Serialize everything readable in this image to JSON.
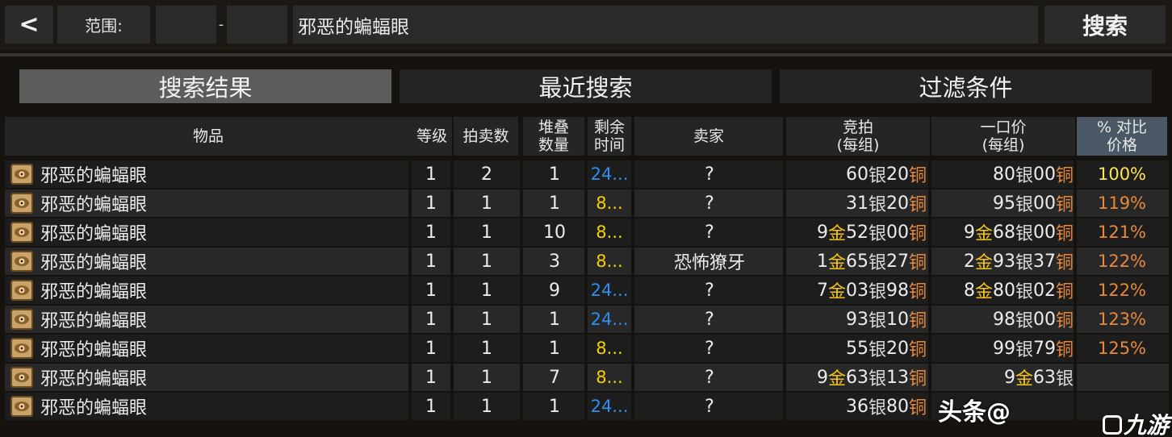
{
  "header": {
    "back_label": "<",
    "range_label": "范围:",
    "range_min": "",
    "range_dash": "-",
    "range_max": "",
    "search_value": "邪恶的蝙蝠眼",
    "search_button": "搜索"
  },
  "tabs": [
    {
      "label": "搜索结果",
      "active": true
    },
    {
      "label": "最近搜索",
      "active": false
    },
    {
      "label": "过滤条件",
      "active": false
    }
  ],
  "columns": {
    "item": "物品",
    "level": "等级",
    "bids": "拍卖数",
    "stack_1": "堆叠",
    "stack_2": "数量",
    "time_1": "剩余",
    "time_2": "时间",
    "seller": "卖家",
    "bid_1": "竞拍",
    "bid_2": "(每组)",
    "buyout_1": "一口价",
    "buyout_2": "(每组)",
    "pct_1": "% 对比",
    "pct_2": "价格"
  },
  "rows": [
    {
      "item": "邪恶的蝙蝠眼",
      "level": "1",
      "bids": "2",
      "stack": "1",
      "time": "24...",
      "seller": "?",
      "bid": {
        "g": "",
        "s": "60",
        "c": "20"
      },
      "buyout": {
        "g": "",
        "s": "80",
        "c": "00"
      },
      "pct": "100%"
    },
    {
      "item": "邪恶的蝙蝠眼",
      "level": "1",
      "bids": "1",
      "stack": "1",
      "time": "8...",
      "seller": "?",
      "bid": {
        "g": "",
        "s": "31",
        "c": "20"
      },
      "buyout": {
        "g": "",
        "s": "95",
        "c": "00"
      },
      "pct": "119%"
    },
    {
      "item": "邪恶的蝙蝠眼",
      "level": "1",
      "bids": "1",
      "stack": "10",
      "time": "8...",
      "seller": "?",
      "bid": {
        "g": "9",
        "s": "52",
        "c": "00"
      },
      "buyout": {
        "g": "9",
        "s": "68",
        "c": "00"
      },
      "pct": "121%"
    },
    {
      "item": "邪恶的蝙蝠眼",
      "level": "1",
      "bids": "1",
      "stack": "3",
      "time": "8...",
      "seller": "恐怖獠牙",
      "bid": {
        "g": "1",
        "s": "65",
        "c": "27"
      },
      "buyout": {
        "g": "2",
        "s": "93",
        "c": "37"
      },
      "pct": "122%"
    },
    {
      "item": "邪恶的蝙蝠眼",
      "level": "1",
      "bids": "1",
      "stack": "9",
      "time": "24...",
      "seller": "?",
      "bid": {
        "g": "7",
        "s": "03",
        "c": "98"
      },
      "buyout": {
        "g": "8",
        "s": "80",
        "c": "02"
      },
      "pct": "122%"
    },
    {
      "item": "邪恶的蝙蝠眼",
      "level": "1",
      "bids": "1",
      "stack": "1",
      "time": "24...",
      "seller": "?",
      "bid": {
        "g": "",
        "s": "93",
        "c": "10"
      },
      "buyout": {
        "g": "",
        "s": "98",
        "c": "00"
      },
      "pct": "123%"
    },
    {
      "item": "邪恶的蝙蝠眼",
      "level": "1",
      "bids": "1",
      "stack": "1",
      "time": "8...",
      "seller": "?",
      "bid": {
        "g": "",
        "s": "55",
        "c": "20"
      },
      "buyout": {
        "g": "",
        "s": "99",
        "c": "79"
      },
      "pct": "125%"
    },
    {
      "item": "邪恶的蝙蝠眼",
      "level": "1",
      "bids": "1",
      "stack": "7",
      "time": "8...",
      "seller": "?",
      "bid": {
        "g": "9",
        "s": "63",
        "c": "13"
      },
      "buyout": {
        "g": "9",
        "s": "63",
        "c": ""
      },
      "pct": ""
    },
    {
      "item": "邪恶的蝙蝠眼",
      "level": "1",
      "bids": "1",
      "stack": "1",
      "time": "24...",
      "seller": "?",
      "bid": {
        "g": "",
        "s": "36",
        "c": "80"
      },
      "buyout": {
        "g": "",
        "s": "",
        "c": ""
      },
      "pct": ""
    }
  ],
  "currency": {
    "gold": "金",
    "silver": "银",
    "copper": "铜"
  },
  "watermarks": {
    "toutiao": "头条@",
    "site": "九游"
  },
  "colors": {
    "time_long": "#2e8ff0",
    "time_short": "#f5d000",
    "pct_base": "#ffe44a",
    "pct_high": "#e8893a",
    "gold": "#f5c518",
    "copper": "#e8893a"
  }
}
